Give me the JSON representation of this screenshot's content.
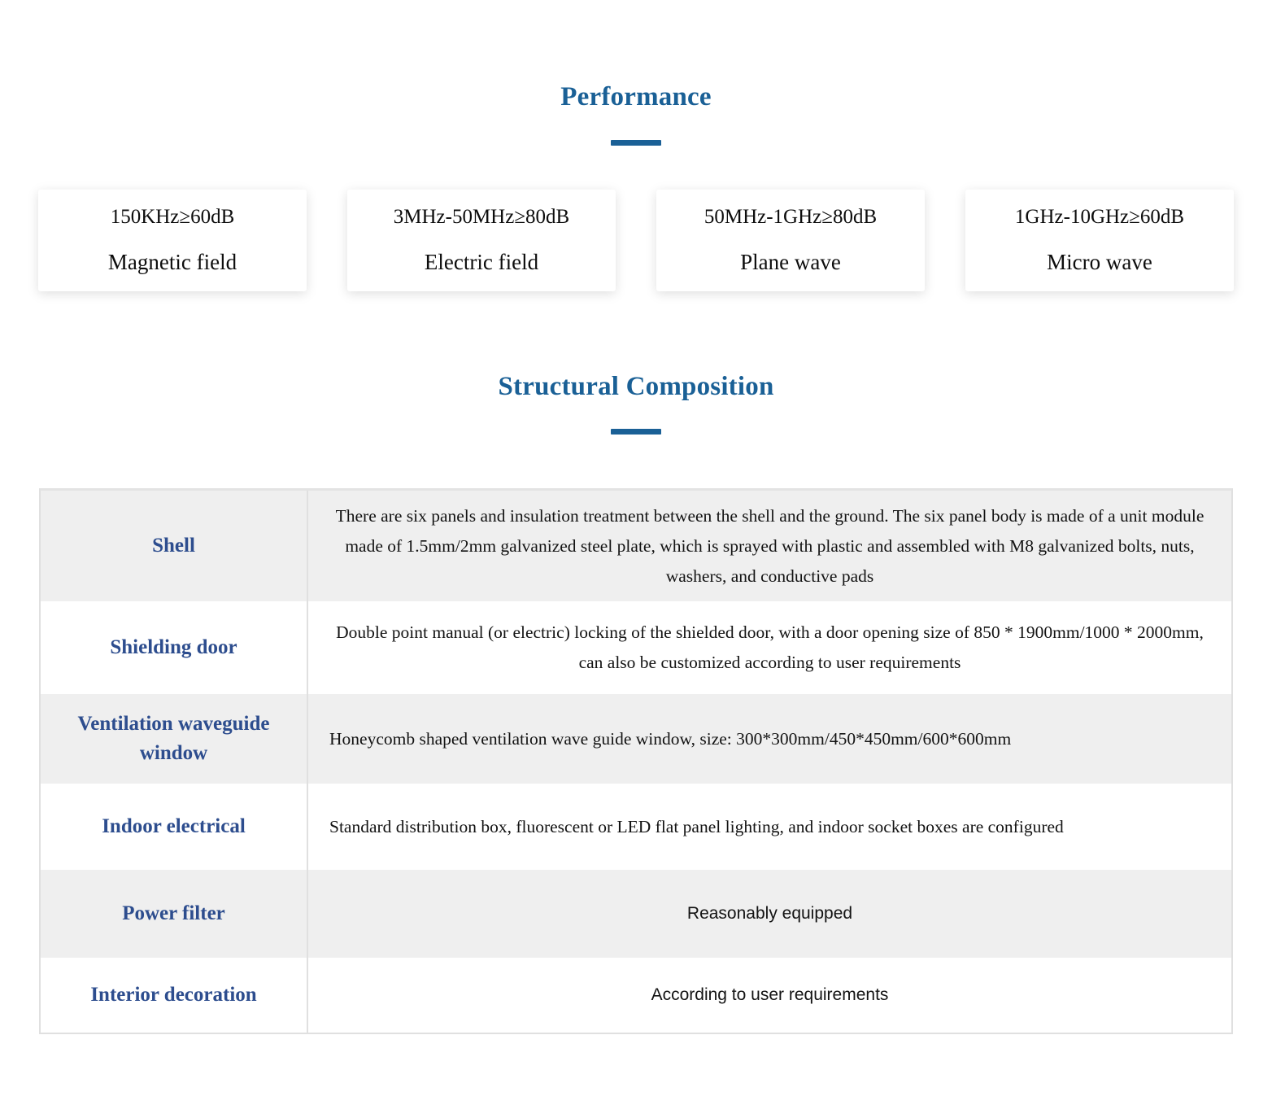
{
  "performance": {
    "title": "Performance",
    "cards": [
      {
        "spec": "150KHz≥60dB",
        "kind": "Magnetic field"
      },
      {
        "spec": "3MHz-50MHz≥80dB",
        "kind": "Electric field"
      },
      {
        "spec": "50MHz-1GHz≥80dB",
        "kind": "Plane wave"
      },
      {
        "spec": "1GHz-10GHz≥60dB",
        "kind": "Micro wave"
      }
    ]
  },
  "structural": {
    "title": "Structural Composition",
    "rows": [
      {
        "label": "Shell",
        "description": "There are six panels and insulation treatment between the shell and the ground. The six panel body is made of a unit module made of 1.5mm/2mm galvanized steel plate, which is sprayed with plastic and assembled with M8 galvanized bolts, nuts, washers, and conductive pads"
      },
      {
        "label": "Shielding door",
        "description": "Double point manual (or electric) locking of the shielded door, with a door opening size of 850 * 1900mm/1000 * 2000mm, can also be customized according to user requirements"
      },
      {
        "label": "Ventilation waveguide window",
        "description": "Honeycomb shaped ventilation wave guide window, size: 300*300mm/450*450mm/600*600mm"
      },
      {
        "label": "Indoor electrical",
        "description": "Standard distribution box, fluorescent or LED flat panel lighting, and indoor socket boxes are configured"
      },
      {
        "label": "Power filter",
        "description": "Reasonably equipped"
      },
      {
        "label": "Interior decoration",
        "description": "According to user requirements"
      }
    ]
  },
  "colors": {
    "heading_blue": "#1a6096",
    "label_navy": "#2d4d8e",
    "row_shade": "#efefef",
    "table_border": "#e0e0e0"
  }
}
